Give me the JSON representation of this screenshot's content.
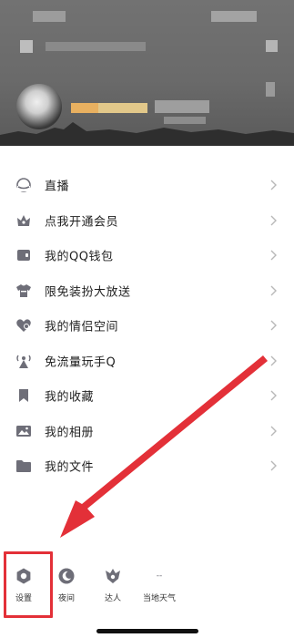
{
  "menu": {
    "items": [
      {
        "label": "直播",
        "icon": "live-icon"
      },
      {
        "label": "点我开通会员",
        "icon": "vip-crown-icon"
      },
      {
        "label": "我的QQ钱包",
        "icon": "wallet-icon"
      },
      {
        "label": "限免装扮大放送",
        "icon": "shirt-icon"
      },
      {
        "label": "我的情侣空间",
        "icon": "heart-icon"
      },
      {
        "label": "免流量玩手Q",
        "icon": "antenna-icon"
      },
      {
        "label": "我的收藏",
        "icon": "bookmark-icon"
      },
      {
        "label": "我的相册",
        "icon": "photo-icon"
      },
      {
        "label": "我的文件",
        "icon": "folder-icon"
      }
    ]
  },
  "bottom_bar": {
    "settings_label": "设置",
    "night_label": "夜间",
    "expert_label": "达人",
    "weather_label": "当地天气",
    "weather_value": "--"
  },
  "colors": {
    "icon": "#6e6e78",
    "annotation": "#e33038",
    "chevron": "#b8b8b8"
  }
}
